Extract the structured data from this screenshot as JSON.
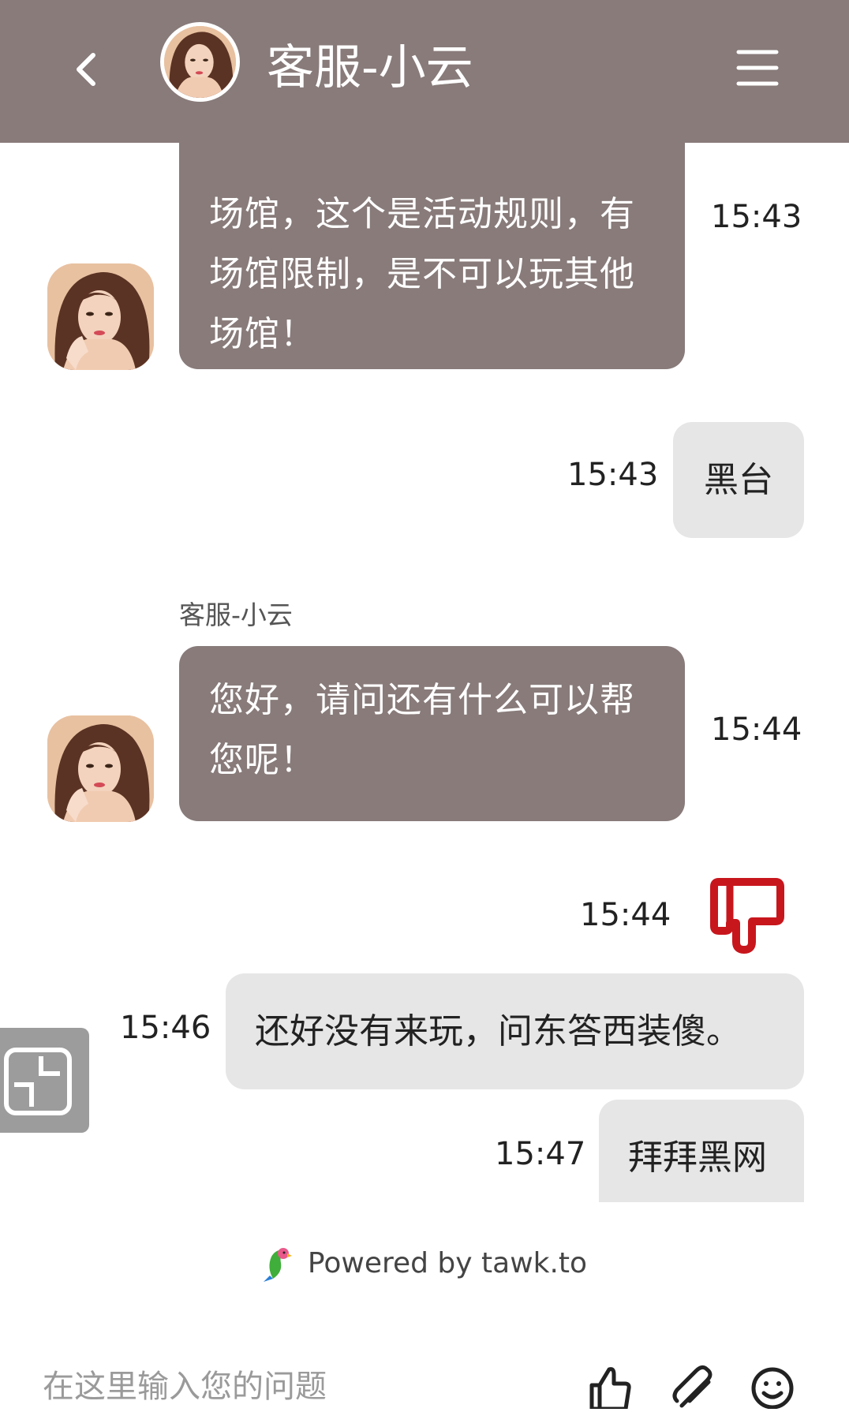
{
  "header": {
    "title": "客服-小云",
    "back_icon": "chevron-left-icon",
    "menu_icon": "hamburger-menu-icon",
    "background_color": "#887b7a"
  },
  "messages": [
    {
      "from": "agent",
      "lines": [
        "场馆，这个是活动规则，有",
        "场馆限制，是不可以玩其他",
        "场馆！"
      ],
      "time": "15:43"
    },
    {
      "from": "visitor",
      "text": "黑台",
      "time": "15:43"
    },
    {
      "from": "agent",
      "sender": "客服-小云",
      "lines": [
        "您好，请问还有什么可以帮",
        "您呢！"
      ],
      "time": "15:44"
    },
    {
      "from": "system",
      "type": "rating",
      "icon": "thumbs-down-icon",
      "time": "15:44",
      "color": "#c8161d"
    },
    {
      "from": "visitor",
      "text": "还好没有来玩，问东答西装傻。",
      "time": "15:46"
    },
    {
      "from": "visitor",
      "text": "拜拜黑网",
      "time": "15:47"
    }
  ],
  "footer": {
    "powered_by": "Powered by tawk.to",
    "input_placeholder": "在这里输入您的问题",
    "icons": [
      "thumbs-up-icon",
      "paperclip-icon",
      "emoji-icon"
    ]
  }
}
